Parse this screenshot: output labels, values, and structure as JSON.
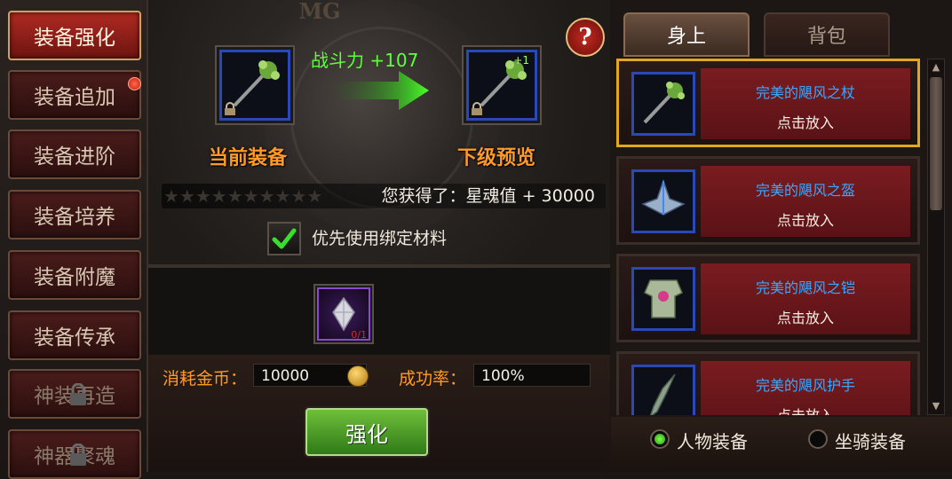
{
  "sidebar": {
    "items": [
      {
        "label": "装备强化"
      },
      {
        "label": "装备追加"
      },
      {
        "label": "装备进阶"
      },
      {
        "label": "装备培养"
      },
      {
        "label": "装备附魔"
      },
      {
        "label": "装备传承"
      },
      {
        "label": "神装再造"
      },
      {
        "label": "神器聚魂"
      }
    ]
  },
  "main": {
    "logo": "MG",
    "help": "?",
    "power_gain": "战斗力 +107",
    "current_label": "当前装备",
    "next_label": "下级预览",
    "next_level_badge": "+1",
    "gain_text": "您获得了：星魂值 + 30000",
    "stars": "★★★★★★★★★★",
    "prefer_bound_label": "优先使用绑定材料",
    "prefer_bound_checked": true,
    "material_count": "0/1",
    "cost_label": "消耗金币：",
    "cost_value": "10000",
    "rate_label": "成功率：",
    "rate_value": "100%",
    "enhance_button": "强化"
  },
  "right": {
    "tabs": [
      {
        "label": "身上",
        "active": true
      },
      {
        "label": "背包",
        "active": false
      }
    ],
    "items": [
      {
        "name": "完美的飓风之杖",
        "action": "点击放入",
        "icon": "staff-icon",
        "selected": true
      },
      {
        "name": "完美的飓风之盔",
        "action": "点击放入",
        "icon": "helmet-icon",
        "selected": false
      },
      {
        "name": "完美的飓风之铠",
        "action": "点击放入",
        "icon": "armor-icon",
        "selected": false
      },
      {
        "name": "完美的飓风护手",
        "action": "点击放入",
        "icon": "gauntlet-icon",
        "selected": false
      }
    ],
    "filters": [
      {
        "label": "人物装备",
        "on": true
      },
      {
        "label": "坐骑装备",
        "on": false
      }
    ]
  },
  "colors": {
    "accent_orange": "#ff9a28",
    "power_green": "#5dff3a",
    "item_name_blue": "#3aa8ff",
    "selected_border": "#e0a820"
  }
}
